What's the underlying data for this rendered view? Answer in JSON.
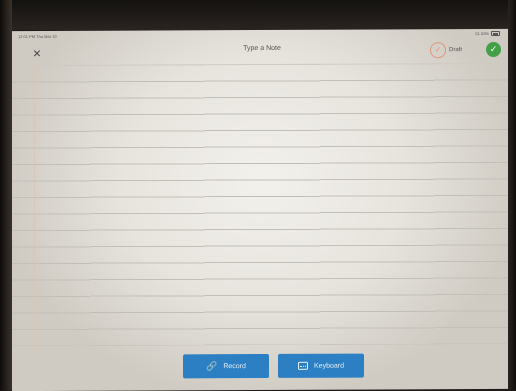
{
  "status_bar": {
    "time": "12:01 PM  Thu Mar 19",
    "battery": "51 63%"
  },
  "nav": {
    "close_icon": "×",
    "title": "Type a Note",
    "draft_icon": "✓",
    "draft_label": "Draft",
    "done_icon": "✓"
  },
  "note": {
    "content": ""
  },
  "toolbar": {
    "record_label": "Record",
    "record_icon": "🔗",
    "keyboard_label": "Keyboard"
  },
  "colors": {
    "accent_blue": "#2c7fc2",
    "done_green": "#43a047",
    "draft_orange": "#e3947a"
  }
}
